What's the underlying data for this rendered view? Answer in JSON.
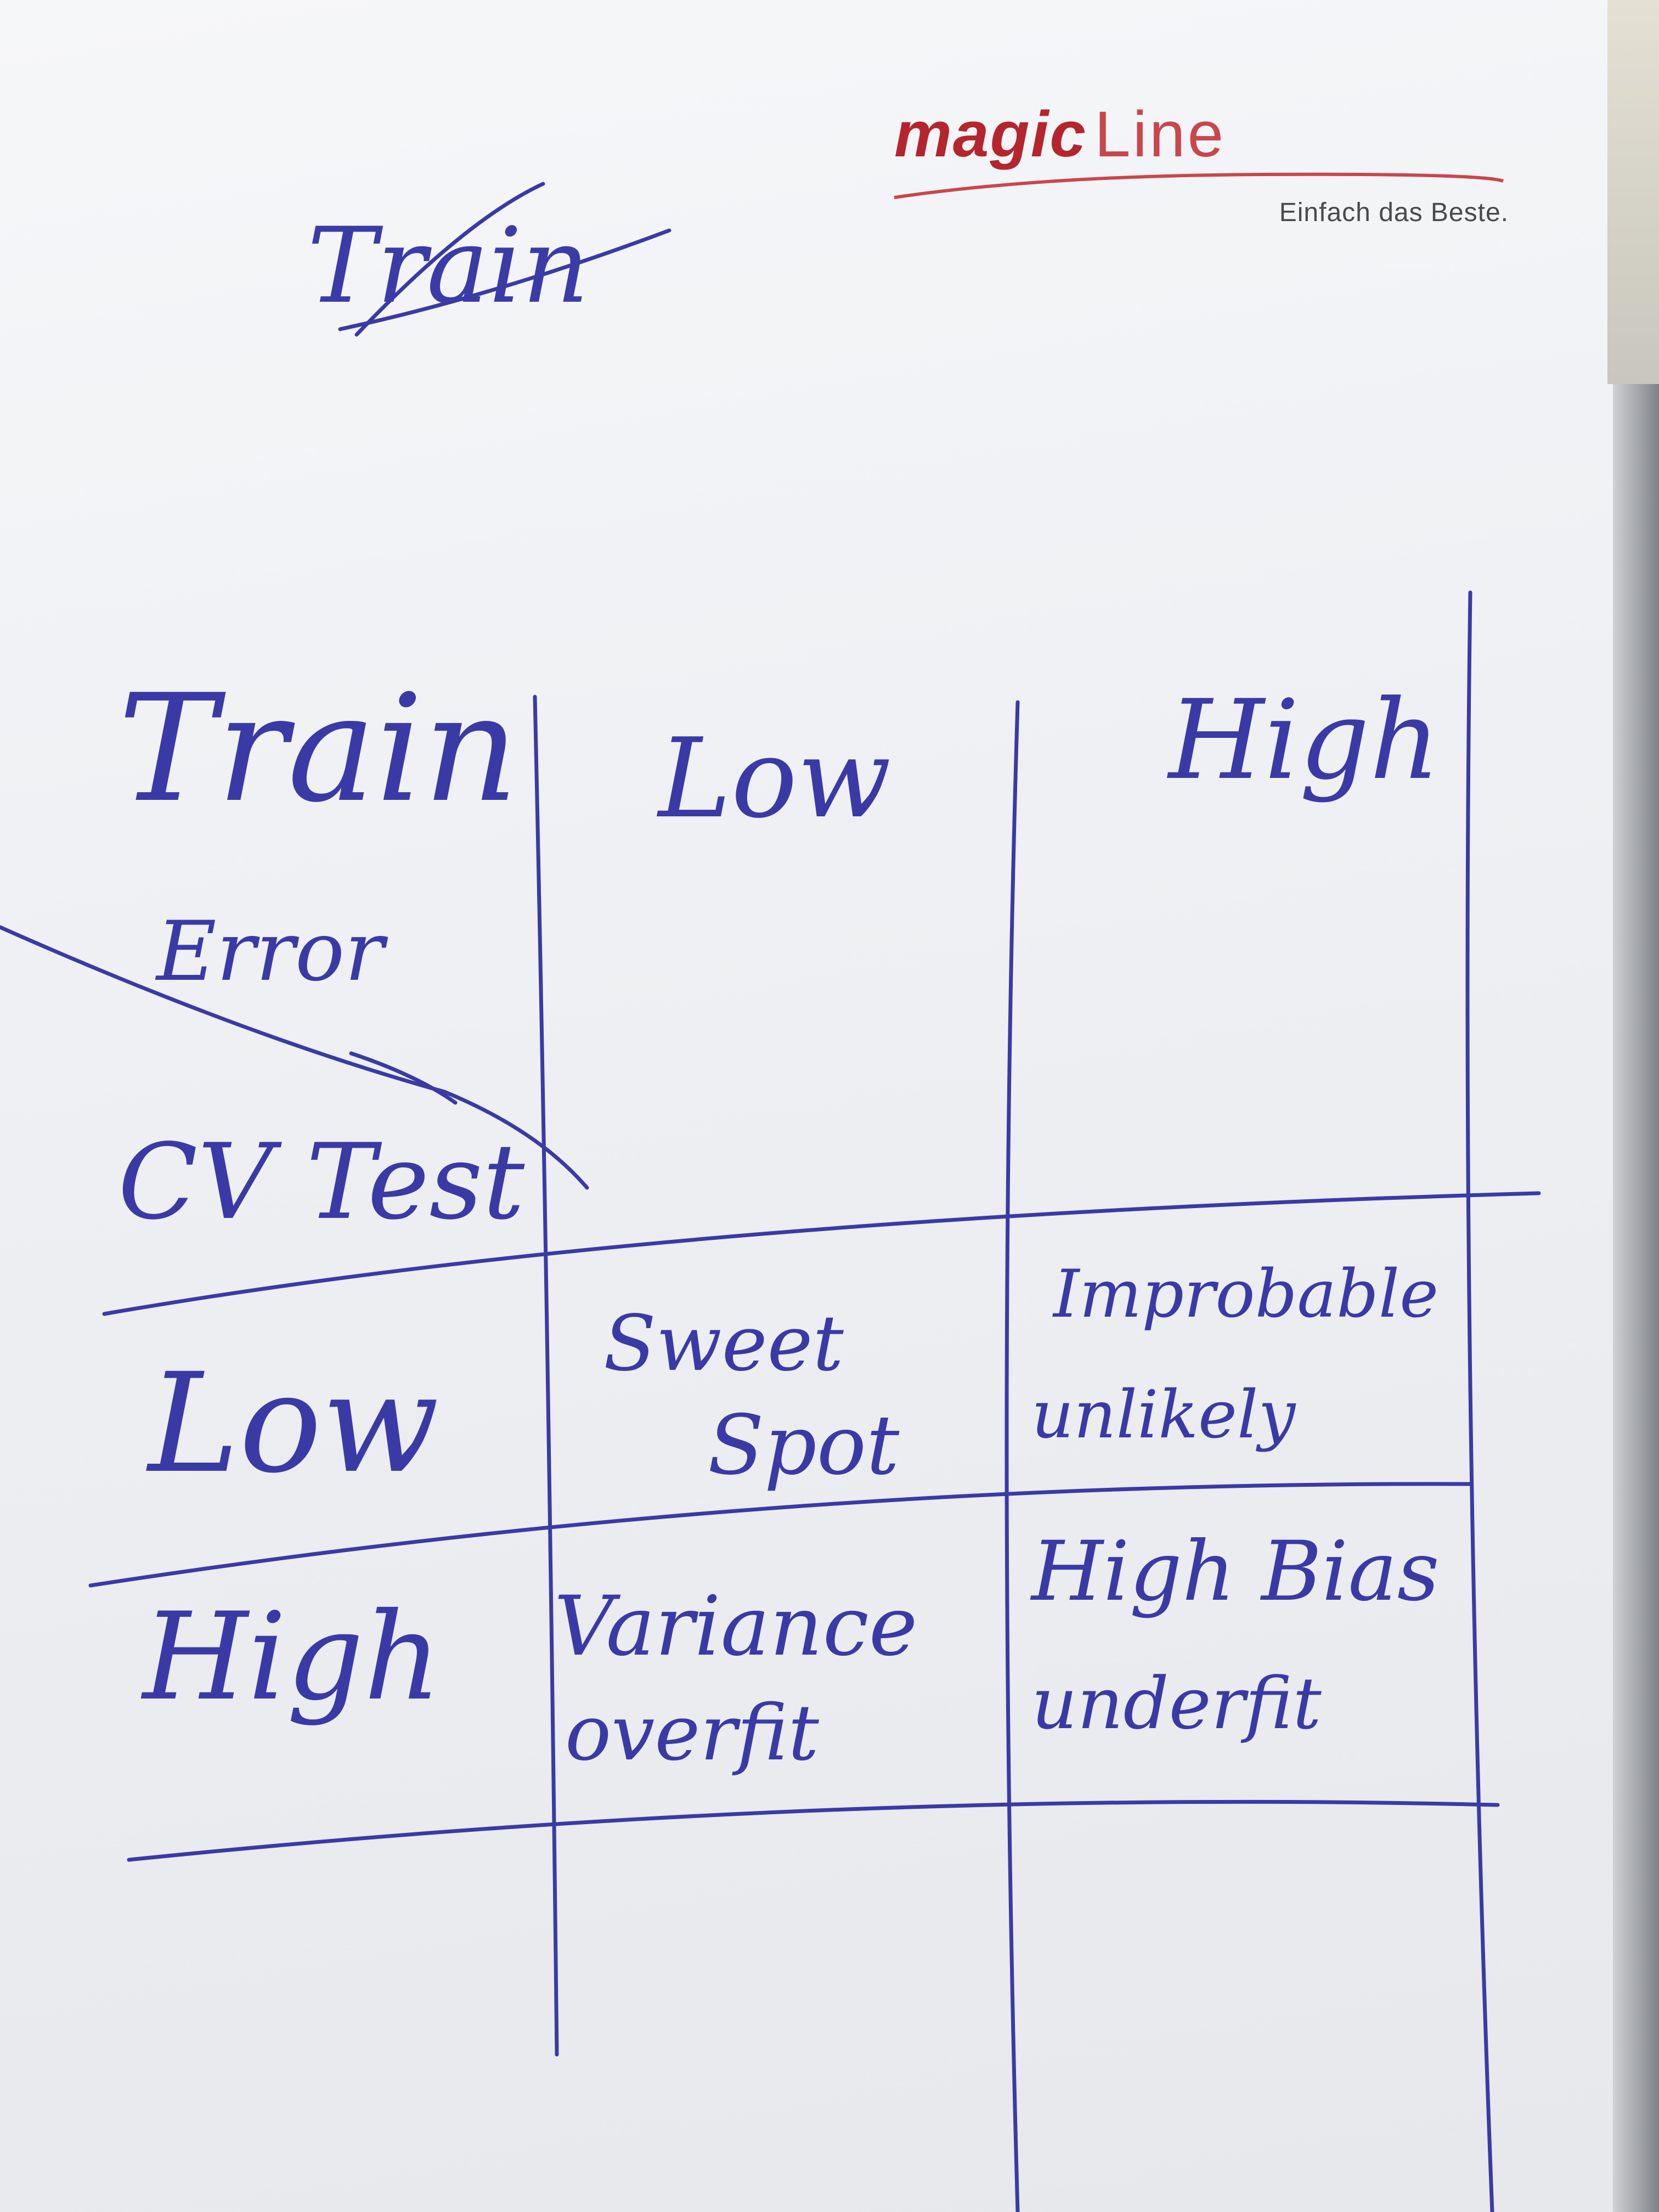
{
  "header": {
    "logo_text_1": "magic",
    "logo_text_2": "Line",
    "tagline": "Einfach das Beste."
  },
  "note": {
    "top_scribble": "Train",
    "corner_top": "Train",
    "corner_top_2": "Error",
    "corner_bottom": "CV Test",
    "column_headers": [
      "Low",
      "High"
    ],
    "row_headers": [
      "Low",
      "High"
    ],
    "cells": {
      "low_low_1": "Sweet",
      "low_low_2": "Spot",
      "low_high_1": "Improbable",
      "low_high_2": "unlikely",
      "high_low_1": "Variance",
      "high_low_2": "overfit",
      "high_high_1": "High Bias",
      "high_high_2": "underfit"
    }
  },
  "colors": {
    "ink": "#3a3aa6",
    "logo": "#b5252e"
  }
}
